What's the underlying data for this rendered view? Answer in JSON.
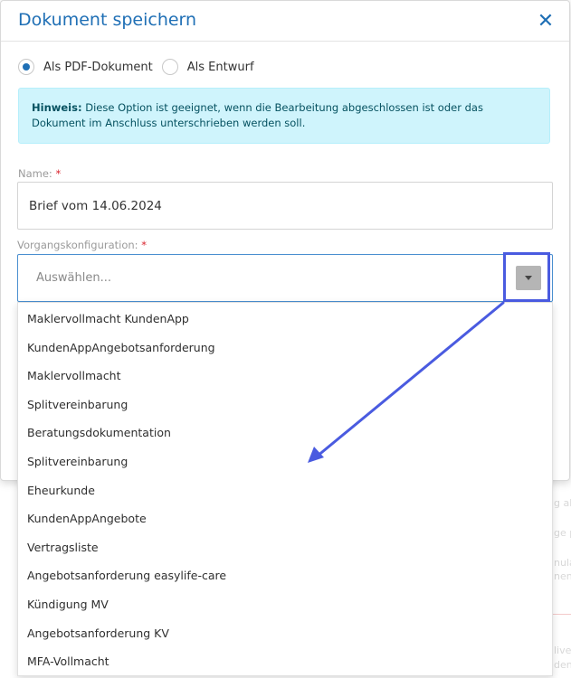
{
  "dialog": {
    "title": "Dokument speichern",
    "close_symbol": "✕"
  },
  "save_options": [
    {
      "label": "Als PDF-Dokument",
      "checked": true
    },
    {
      "label": "Als Entwurf",
      "checked": false
    }
  ],
  "hint": {
    "prefix": "Hinweis:",
    "text": " Diese Option ist geeignet, wenn die Bearbeitung abgeschlossen ist oder das Dokument im Anschluss unterschrieben werden soll."
  },
  "name_field": {
    "label": "Name:",
    "required_marker": "*",
    "value": "Brief vom 14.06.2024"
  },
  "config_field": {
    "label": "Vorgangskonfiguration:",
    "required_marker": "*",
    "placeholder": "Auswählen...",
    "icon": "chevron-down-icon"
  },
  "dropdown_options": [
    "Maklervollmacht KundenApp",
    "KundenAppAngebotsanforderung",
    "Maklervollmacht",
    "Splitvereinbarung",
    "Beratungsdokumentation",
    "Splitvereinbarung",
    "Eheurkunde",
    "KundenAppAngebote",
    "Vertragsliste",
    "Angebotsanforderung easylife-care",
    "Kündigung MV",
    "Angebotsanforderung KV",
    "MFA-Vollmacht"
  ],
  "background_snippets": [
    "g als",
    "ge p",
    "nula",
    "nen",
    "live",
    "den"
  ],
  "colors": {
    "accent": "#1f6fb5",
    "hint_bg": "#cff4fc",
    "annotation": "#4a5be0",
    "required": "#d9232d"
  }
}
